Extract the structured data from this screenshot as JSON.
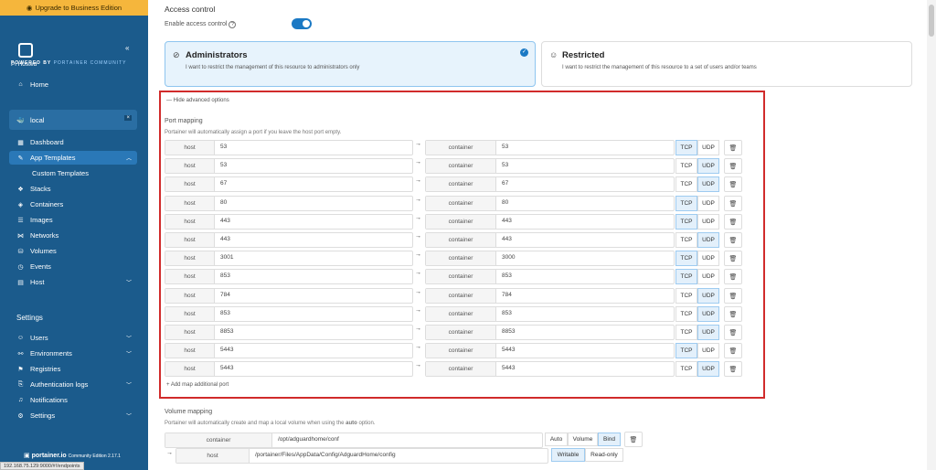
{
  "sidebar": {
    "upgrade_label": "Upgrade to Business Edition",
    "app_name": "Pi Hosted",
    "powered_by": "POWERED BY",
    "powered_community": "PORTAINER COMMUNITY",
    "collapse": "«",
    "home": "Home",
    "environment": "local",
    "environment_close": "×",
    "items": [
      {
        "label": "Dashboard",
        "icon": "▦"
      },
      {
        "label": "App Templates",
        "icon": "✎"
      },
      {
        "label": "Custom Templates",
        "icon": ""
      },
      {
        "label": "Stacks",
        "icon": "❖"
      },
      {
        "label": "Containers",
        "icon": "◈"
      },
      {
        "label": "Images",
        "icon": "☰"
      },
      {
        "label": "Networks",
        "icon": "⋈"
      },
      {
        "label": "Volumes",
        "icon": "⛁"
      },
      {
        "label": "Events",
        "icon": "◷"
      },
      {
        "label": "Host",
        "icon": "▤"
      }
    ],
    "settings_heading": "Settings",
    "settings_items": [
      {
        "label": "Users",
        "icon": "☺"
      },
      {
        "label": "Environments",
        "icon": "⚯"
      },
      {
        "label": "Registries",
        "icon": "⚑"
      },
      {
        "label": "Authentication logs",
        "icon": "⎘"
      },
      {
        "label": "Notifications",
        "icon": "♫"
      },
      {
        "label": "Settings",
        "icon": "⚙"
      }
    ],
    "footer_brand": "portainer.io",
    "footer_edition": "Community Edition 2.17.1",
    "status_url": "192.168.75.129:9000/#!/endpoints"
  },
  "access": {
    "title": "Access control",
    "enable_label": "Enable access control",
    "help_glyph": "?",
    "admin_title": "Administrators",
    "admin_desc": "I want to restrict the management of this resource to administrators only",
    "restricted_title": "Restricted",
    "restricted_desc": "I want to restrict the management of this resource to a set of users and/or teams"
  },
  "advanced": {
    "hide_label": "— Hide advanced options",
    "port_title": "Port mapping",
    "port_desc": "Portainer will automatically assign a port if you leave the host port empty.",
    "host_label": "host",
    "container_label": "container",
    "tcp": "TCP",
    "udp": "UDP",
    "add_label": "+ Add map additional port",
    "ports": [
      {
        "host": "53",
        "container": "53",
        "proto": "TCP"
      },
      {
        "host": "53",
        "container": "53",
        "proto": "UDP"
      },
      {
        "host": "67",
        "container": "67",
        "proto": "UDP"
      },
      {
        "host": "80",
        "container": "80",
        "proto": "TCP"
      },
      {
        "host": "443",
        "container": "443",
        "proto": "TCP"
      },
      {
        "host": "443",
        "container": "443",
        "proto": "UDP"
      },
      {
        "host": "3001",
        "container": "3000",
        "proto": "TCP"
      },
      {
        "host": "853",
        "container": "853",
        "proto": "TCP"
      },
      {
        "host": "784",
        "container": "784",
        "proto": "UDP"
      },
      {
        "host": "853",
        "container": "853",
        "proto": "UDP"
      },
      {
        "host": "8853",
        "container": "8853",
        "proto": "UDP"
      },
      {
        "host": "5443",
        "container": "5443",
        "proto": "TCP"
      },
      {
        "host": "5443",
        "container": "5443",
        "proto": "UDP"
      }
    ]
  },
  "volume": {
    "title": "Volume mapping",
    "desc_pre": "Portainer will automatically create and map a local volume when using the ",
    "desc_bold": "auto",
    "desc_post": " option.",
    "container_label": "container",
    "container_value": "/opt/adguardhome/conf",
    "auto": "Auto",
    "volume": "Volume",
    "bind": "Bind",
    "host_label": "host",
    "host_value": "/portainer/Files/AppData/Config/AdguardHome/config",
    "writable": "Writable",
    "readonly": "Read-only"
  }
}
